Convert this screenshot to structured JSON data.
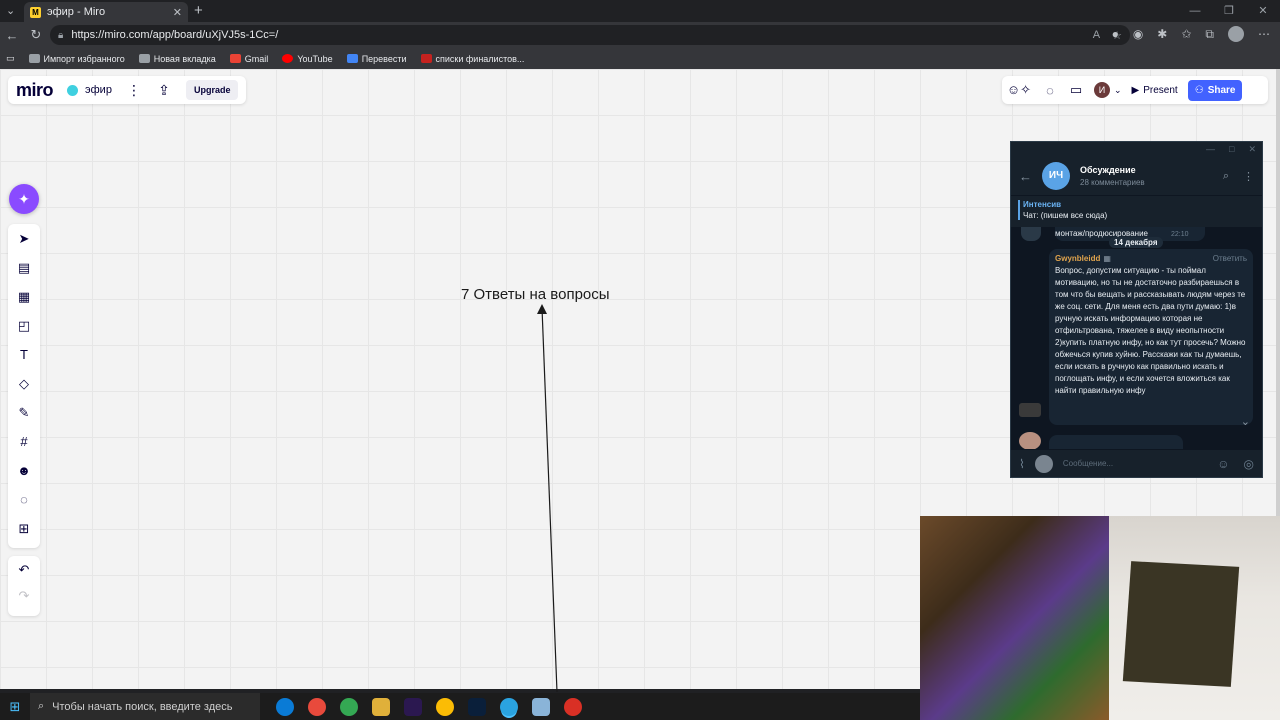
{
  "browser": {
    "tab_title": "эфир - Miro",
    "tab_favicon": "M",
    "url": "https://miro.com/app/board/uXjVJ5s-1Cc=/",
    "bookmarks": [
      {
        "label": "Импорт избранного",
        "color": "#9aa0a6"
      },
      {
        "label": "Новая вкладка",
        "color": "#9aa0a6"
      },
      {
        "label": "Gmail",
        "color": "#ea4335"
      },
      {
        "label": "YouTube",
        "color": "#ff0000"
      },
      {
        "label": "Перевести",
        "color": "#4285f4"
      },
      {
        "label": "списки финалистов...",
        "color": "#c5221f"
      }
    ]
  },
  "miro": {
    "logo": "miro",
    "board_name": "эфир",
    "upgrade_label": "Upgrade",
    "user_initial": "И",
    "present_label": "Present",
    "share_label": "Share",
    "canvas_text": "7 Ответы на вопросы"
  },
  "telegram": {
    "avatar_initials": "ИЧ",
    "title": "Обсуждение",
    "subtitle": "28 комментариев",
    "pinned_title": "Интенсив",
    "pinned_text": "Чат: (пишем все сюда)",
    "prev_message": "монтаж/продюсирование",
    "prev_time": "22:10",
    "date_badge": "14 декабря",
    "author": "Gwynbleidd",
    "reply_label": "Ответить",
    "message": "Вопрос, допустим ситуацию - ты поймал мотивацию, но ты не достаточно разбираешься в том что бы вещать и рассказывать людям через те же соц. сети. Для меня есть два пути думаю: 1)в ручную искать информацию которая не отфильтрована, тяжелее в виду неопытности 2)купить платную инфу, но как тут просечь? Можно обжечься купив хуйню. Расскажи как ты думаешь, если искать в ручную как правильно искать и поглощать инфу, и если хочется вложиться как найти правильную инфу",
    "input_placeholder": "Сообщение..."
  },
  "taskbar": {
    "search_placeholder": "Чтобы начать поиск, введите здесь"
  },
  "colors": {
    "miro_share": "#4262ff",
    "miro_ai": "#8a4bff",
    "tg_bg": "#17212b",
    "tg_author": "#e0a44d"
  }
}
